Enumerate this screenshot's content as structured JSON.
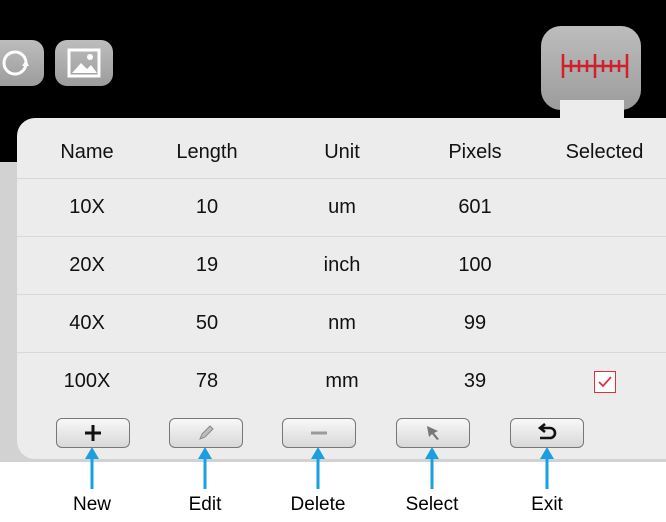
{
  "table": {
    "headers": {
      "name": "Name",
      "length": "Length",
      "unit": "Unit",
      "pixels": "Pixels",
      "selected": "Selected"
    },
    "rows": [
      {
        "name": "10X",
        "length": "10",
        "unit": "um",
        "pixels": "601",
        "selected": false
      },
      {
        "name": "20X",
        "length": "19",
        "unit": "inch",
        "pixels": "100",
        "selected": false
      },
      {
        "name": "40X",
        "length": "50",
        "unit": "nm",
        "pixels": "99",
        "selected": false
      },
      {
        "name": "100X",
        "length": "78",
        "unit": "mm",
        "pixels": "39",
        "selected": true
      }
    ]
  },
  "toolbar": {
    "new_icon": "plus-icon",
    "edit_icon": "pencil-icon",
    "delete_icon": "minus-icon",
    "select_icon": "cursor-arrow-icon",
    "exit_icon": "return-arrow-icon"
  },
  "callouts": {
    "new": "New",
    "edit": "Edit",
    "delete": "Delete",
    "select": "Select",
    "exit": "Exit"
  },
  "colors": {
    "ruler_red": "#d0202a",
    "checkbox_red": "#e0303a",
    "callout_blue": "#1aa0e0"
  }
}
